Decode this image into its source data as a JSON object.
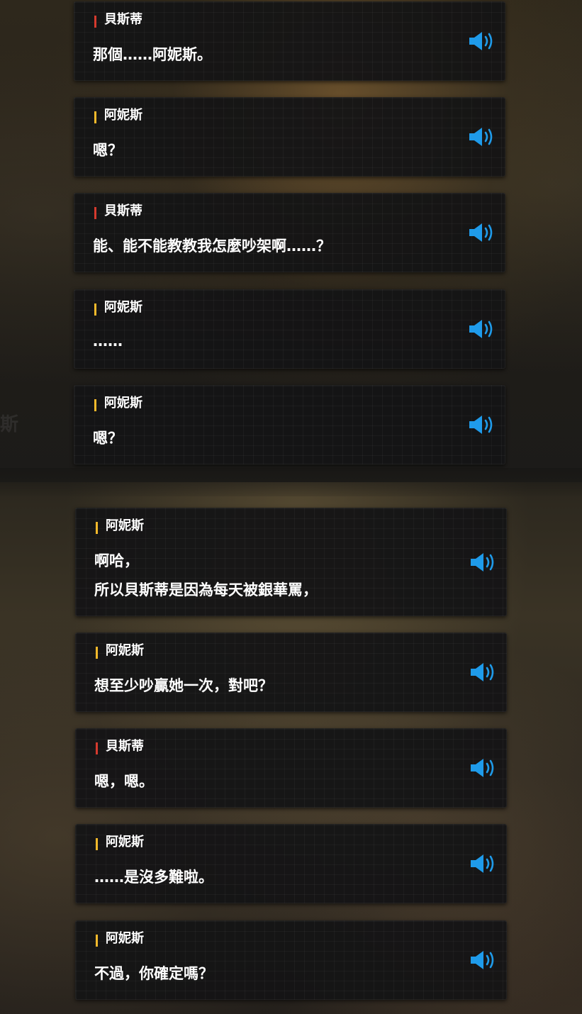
{
  "colors": {
    "besti_accent": "#d53a2e",
    "annis_accent": "#f4b92b",
    "sound_icon": "#1f9bea",
    "card_bg": "#141415",
    "text": "#ffffff"
  },
  "background": {
    "side_text": "斯"
  },
  "dialogues": [
    {
      "speaker": "貝斯蒂",
      "accent": "besti",
      "lines": [
        "那個……阿妮斯。"
      ],
      "icon": "speaker-volume-icon"
    },
    {
      "speaker": "阿妮斯",
      "accent": "annis",
      "lines": [
        "嗯？"
      ],
      "icon": "speaker-volume-icon"
    },
    {
      "speaker": "貝斯蒂",
      "accent": "besti",
      "lines": [
        "能、能不能教教我怎麼吵架啊……？"
      ],
      "icon": "speaker-volume-icon"
    },
    {
      "speaker": "阿妮斯",
      "accent": "annis",
      "lines": [
        "……"
      ],
      "icon": "speaker-volume-icon"
    },
    {
      "speaker": "阿妮斯",
      "accent": "annis",
      "lines": [
        "嗯？"
      ],
      "icon": "speaker-volume-icon"
    },
    {
      "speaker": "阿妮斯",
      "accent": "annis",
      "lines": [
        "啊哈，",
        "所以貝斯蒂是因為每天被銀華罵，"
      ],
      "icon": "speaker-volume-icon"
    },
    {
      "speaker": "阿妮斯",
      "accent": "annis",
      "lines": [
        "想至少吵贏她一次，對吧？"
      ],
      "icon": "speaker-volume-icon"
    },
    {
      "speaker": "貝斯蒂",
      "accent": "besti",
      "lines": [
        "嗯，嗯。"
      ],
      "icon": "speaker-volume-icon"
    },
    {
      "speaker": "阿妮斯",
      "accent": "annis",
      "lines": [
        "……是沒多難啦。"
      ],
      "icon": "speaker-volume-icon"
    },
    {
      "speaker": "阿妮斯",
      "accent": "annis",
      "lines": [
        "不過，你確定嗎？"
      ],
      "icon": "speaker-volume-icon"
    }
  ]
}
